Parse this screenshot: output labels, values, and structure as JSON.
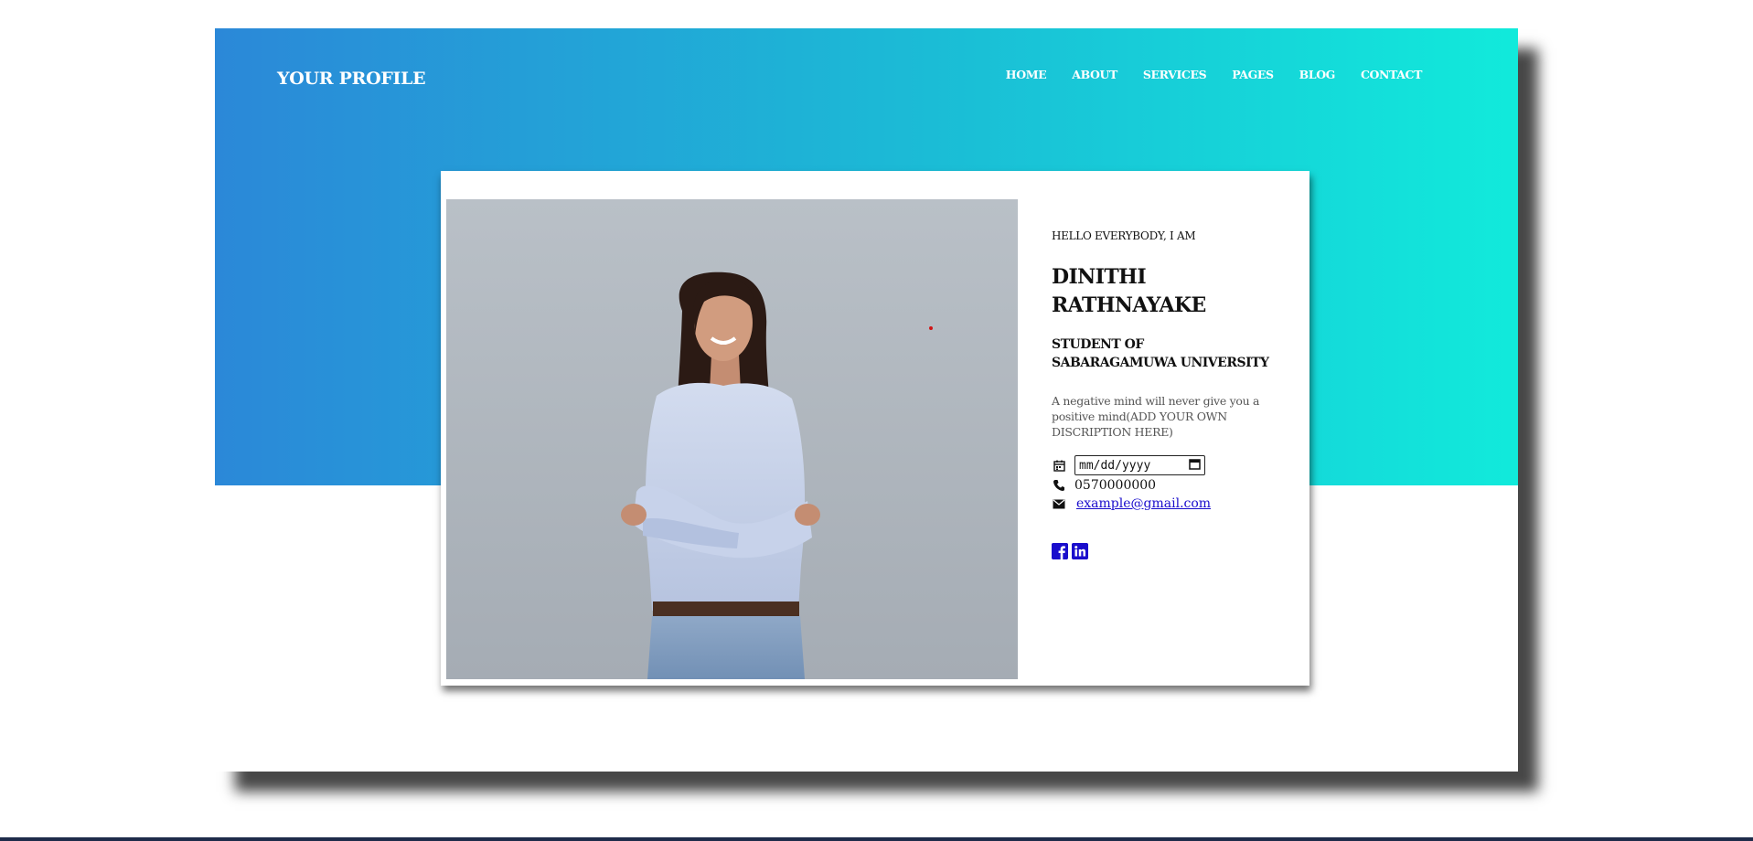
{
  "header": {
    "brand": "YOUR PROFILE",
    "nav": [
      "HOME",
      "ABOUT",
      "SERVICES",
      "PAGES",
      "BLOG",
      "CONTACT"
    ]
  },
  "profile": {
    "greeting": "HELLO EVERYBODY, I AM",
    "name": "DINITHI RATHNAYAKE",
    "subtitle": "STUDENT OF SABARAGAMUWA UNIVERSITY",
    "description": "A negative mind will never give you a positive mind(ADD YOUR OWN DISCRIPTION HERE)",
    "date_placeholder": "mm/dd/yyyy",
    "phone": "0570000000",
    "email": "example@gmail.com"
  },
  "icons": {
    "calendar": "calendar-icon",
    "phone": "phone-icon",
    "email": "envelope-icon",
    "facebook": "facebook-icon",
    "linkedin": "linkedin-icon"
  },
  "colors": {
    "gradient_start": "#2b88d8",
    "gradient_end": "#11eadb",
    "link": "#1a0dcc"
  }
}
